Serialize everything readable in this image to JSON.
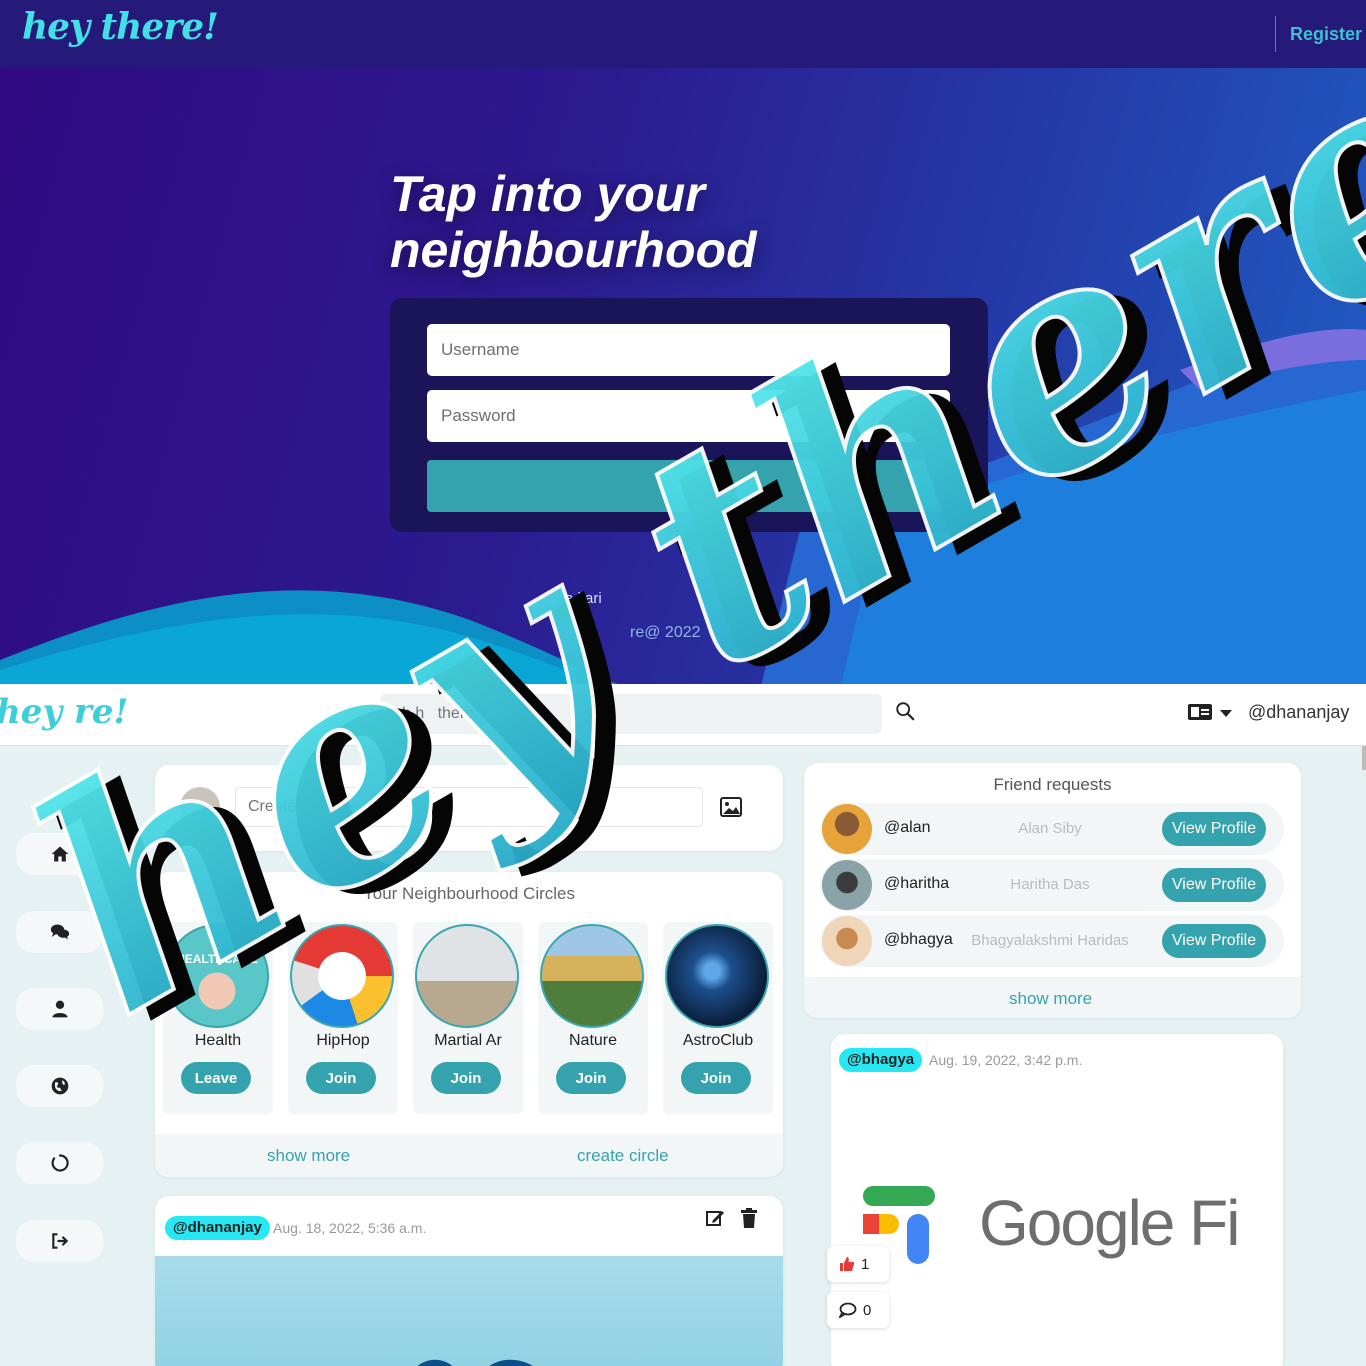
{
  "landing": {
    "logo": "hey there!",
    "register_label": "Register",
    "hero_title": "Tap into your neighbourhood",
    "login": {
      "username_placeholder": "Username",
      "password_placeholder": "Password",
      "button_label": "Lo"
    },
    "footer_tag": "a l        ari",
    "footer_copy": "re@ 2022"
  },
  "app": {
    "logo": "hey   re!",
    "search_placeholder": "ch h   there...",
    "current_user": "@dhananjay",
    "create_post_placeholder": "Create pos",
    "circles": {
      "title": "Your Neighbourhood Circles",
      "items": [
        {
          "name": "Health",
          "action": "Leave",
          "image_text": "HEALTHCARE"
        },
        {
          "name": "HipHop",
          "action": "Join"
        },
        {
          "name": "Martial Ar",
          "action": "Join"
        },
        {
          "name": "Nature",
          "action": "Join"
        },
        {
          "name": "AstroClub",
          "action": "Join"
        }
      ],
      "show_more": "show more",
      "create_circle": "create circle"
    },
    "friend_requests": {
      "title": "Friend requests",
      "items": [
        {
          "handle": "@alan",
          "name": "Alan Siby",
          "action": "View Profile"
        },
        {
          "handle": "@haritha",
          "name": "Haritha Das",
          "action": "View Profile"
        },
        {
          "handle": "@bhagya",
          "name": "Bhagyalakshmi Haridas",
          "action": "View Profile"
        }
      ],
      "show_more": "show more"
    },
    "posts": [
      {
        "user": "@dhananjay",
        "date": "Aug. 18, 2022, 5:36 a.m."
      },
      {
        "user": "@bhagya",
        "date": "Aug. 19, 2022, 3:42 p.m.",
        "image_text": "Google Fi",
        "likes": "1",
        "comments": "0"
      }
    ],
    "sidebar": [
      "home-icon",
      "chat-icon",
      "profile-icon",
      "globe-icon",
      "circle-icon",
      "logout-icon"
    ]
  },
  "watermark_text": "hey there!",
  "colors": {
    "accent": "#35a3ad",
    "brand_cyan": "#42e0e6",
    "tag_cyan": "#27e8f2"
  }
}
